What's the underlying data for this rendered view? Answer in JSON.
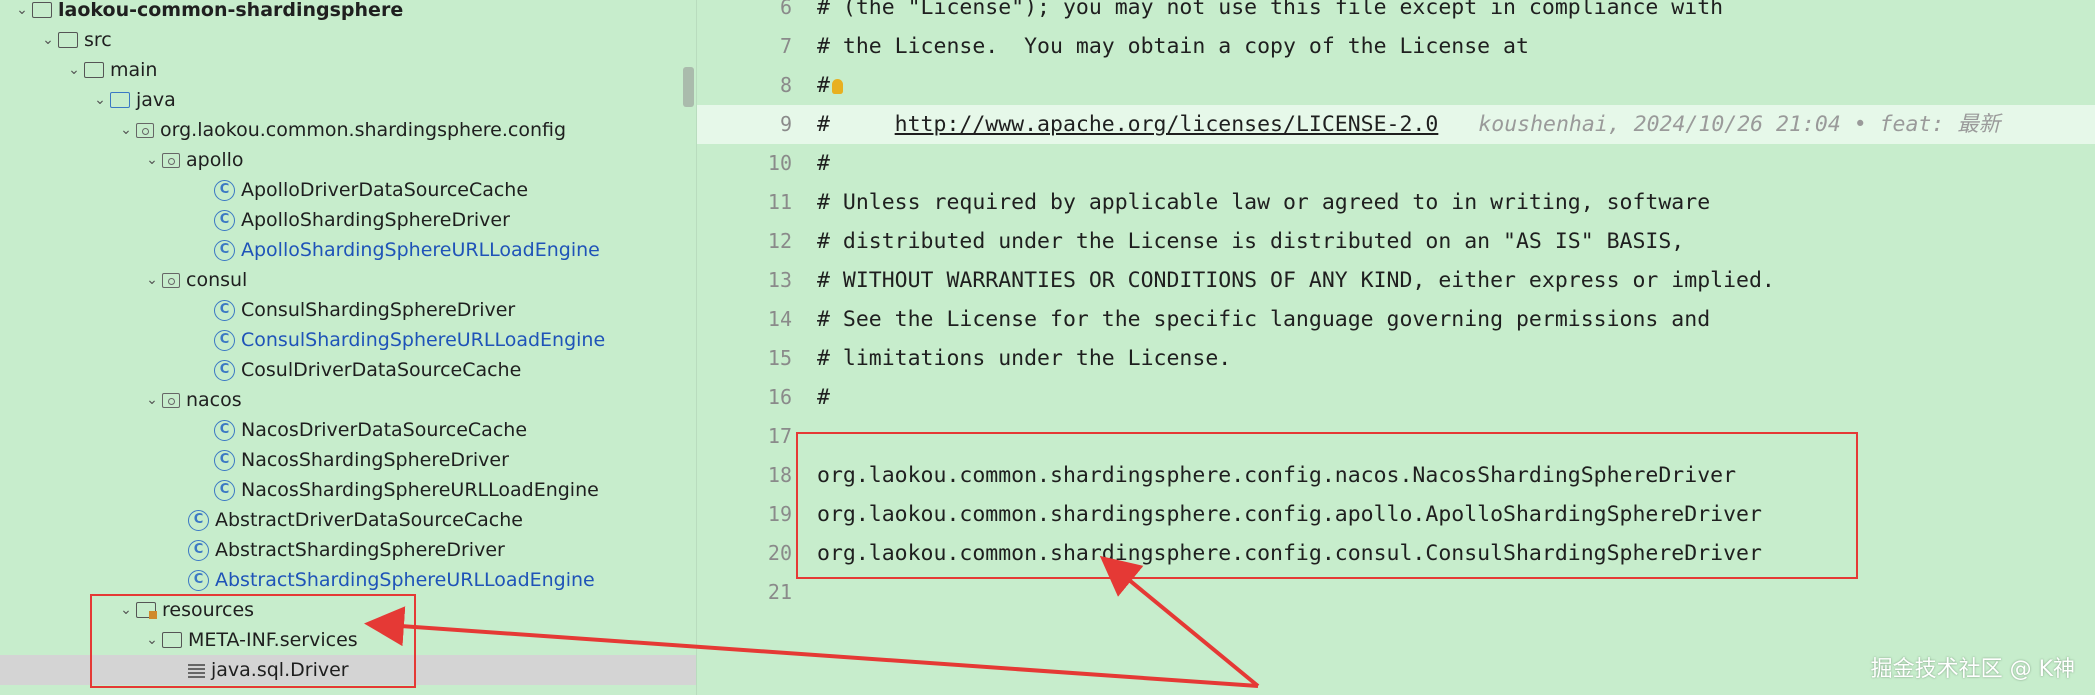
{
  "tree": {
    "items": [
      {
        "label": "laokou-common-shardingsphere",
        "kind": "module",
        "chev": "⌄",
        "bold": true
      },
      {
        "label": "src",
        "kind": "folder",
        "chev": "⌄"
      },
      {
        "label": "main",
        "kind": "folder",
        "chev": "⌄"
      },
      {
        "label": "java",
        "kind": "java-folder",
        "chev": "⌄"
      },
      {
        "label": "org.laokou.common.shardingsphere.config",
        "kind": "package",
        "chev": "⌄"
      },
      {
        "label": "apollo",
        "kind": "package",
        "chev": "⌄"
      },
      {
        "label": "ApolloDriverDataSourceCache",
        "kind": "class",
        "chev": ""
      },
      {
        "label": "ApolloShardingSphereDriver",
        "kind": "class",
        "chev": ""
      },
      {
        "label": "ApolloShardingSphereURLLoadEngine",
        "kind": "class",
        "chev": "",
        "modified": true
      },
      {
        "label": "consul",
        "kind": "package",
        "chev": "⌄"
      },
      {
        "label": "ConsulShardingSphereDriver",
        "kind": "class",
        "chev": ""
      },
      {
        "label": "ConsulShardingSphereURLLoadEngine",
        "kind": "class",
        "chev": "",
        "modified": true
      },
      {
        "label": "CosulDriverDataSourceCache",
        "kind": "class",
        "chev": ""
      },
      {
        "label": "nacos",
        "kind": "package",
        "chev": "⌄"
      },
      {
        "label": "NacosDriverDataSourceCache",
        "kind": "class",
        "chev": ""
      },
      {
        "label": "NacosShardingSphereDriver",
        "kind": "class",
        "chev": ""
      },
      {
        "label": "NacosShardingSphereURLLoadEngine",
        "kind": "class",
        "chev": ""
      },
      {
        "label": "AbstractDriverDataSourceCache",
        "kind": "class",
        "chev": ""
      },
      {
        "label": "AbstractShardingSphereDriver",
        "kind": "class",
        "chev": ""
      },
      {
        "label": "AbstractShardingSphereURLLoadEngine",
        "kind": "class",
        "chev": "",
        "modified": true
      },
      {
        "label": "resources",
        "kind": "resources",
        "chev": "⌄"
      },
      {
        "label": "META-INF.services",
        "kind": "folder",
        "chev": "⌄"
      },
      {
        "label": "java.sql.Driver",
        "kind": "text-file",
        "chev": "",
        "selected": true
      }
    ]
  },
  "editor": {
    "lines": [
      {
        "num": "6",
        "text": "# (the \"License\"); you may not use this file except in compliance with"
      },
      {
        "num": "7",
        "text": "# the License.  You may obtain a copy of the License at"
      },
      {
        "num": "8",
        "text": "#",
        "bulb": true
      },
      {
        "num": "9",
        "text": "#     ",
        "link": "http://www.apache.org/licenses/LICENSE-2.0",
        "blame": "koushenhai, 2024/10/26 21:04 • feat: 最新",
        "current": true
      },
      {
        "num": "10",
        "text": "#"
      },
      {
        "num": "11",
        "text": "# Unless required by applicable law or agreed to in writing, software"
      },
      {
        "num": "12",
        "text": "# distributed under the License is distributed on an \"AS IS\" BASIS,"
      },
      {
        "num": "13",
        "text": "# WITHOUT WARRANTIES OR CONDITIONS OF ANY KIND, either express or implied."
      },
      {
        "num": "14",
        "text": "# See the License for the specific language governing permissions and"
      },
      {
        "num": "15",
        "text": "# limitations under the License."
      },
      {
        "num": "16",
        "text": "#"
      },
      {
        "num": "17",
        "text": ""
      },
      {
        "num": "18",
        "text": "org.laokou.common.shardingsphere.config.nacos.NacosShardingSphereDriver"
      },
      {
        "num": "19",
        "text": "org.laokou.common.shardingsphere.config.apollo.ApolloShardingSphereDriver"
      },
      {
        "num": "20",
        "text": "org.laokou.common.shardingsphere.config.consul.ConsulShardingSphereDriver"
      },
      {
        "num": "21",
        "text": ""
      }
    ]
  },
  "watermark": "掘金技术社区 @ K神",
  "colors": {
    "annotation": "#e53935",
    "background": "#c7edcc",
    "modified": "#1f53b8"
  }
}
